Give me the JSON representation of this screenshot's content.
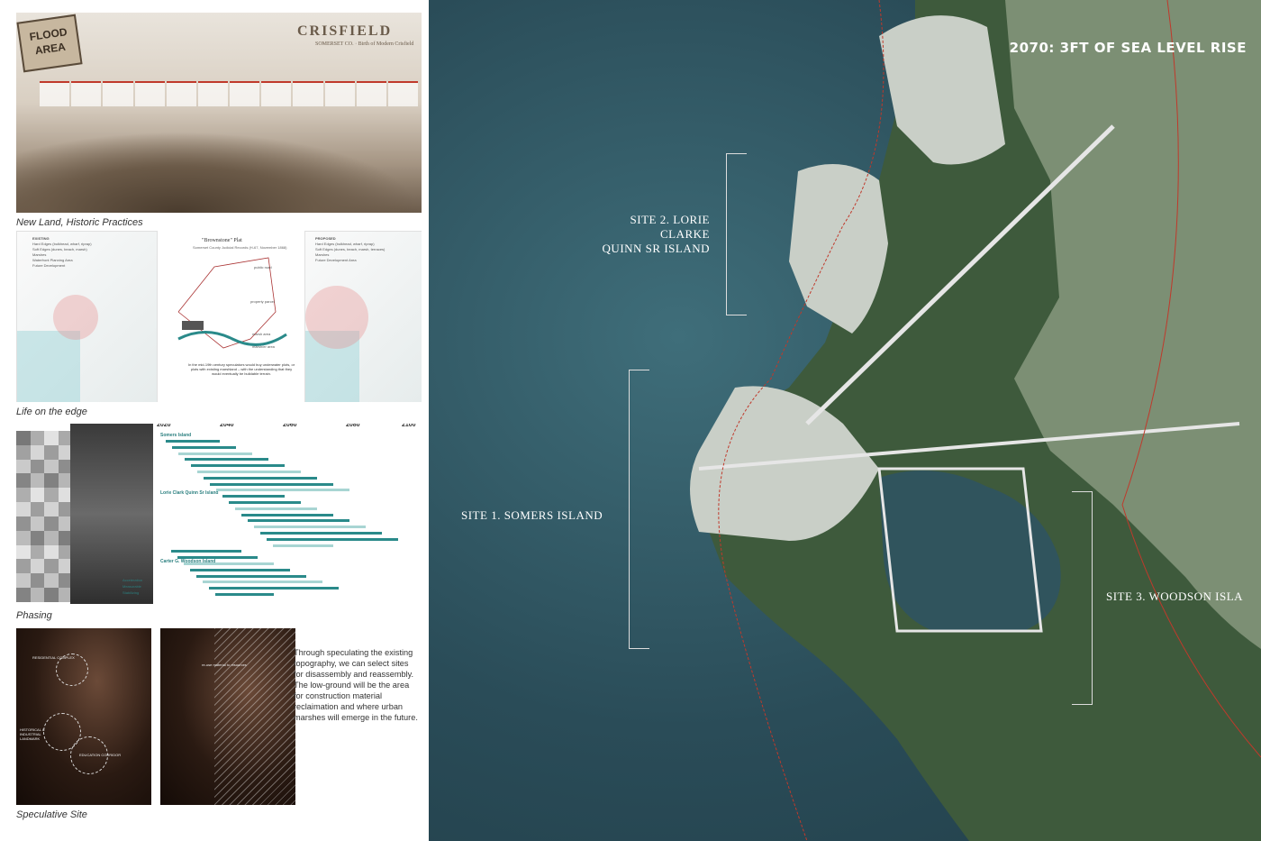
{
  "hero": {
    "sign_text": "FLOOD\nAREA",
    "title": "CRISFIELD",
    "subtitle": "SOMERSET CO. · Birth of Modern Crisfield"
  },
  "captions": {
    "new_land": "New Land, Historic Practices",
    "life": "Life on the edge",
    "phasing": "Phasing",
    "speculative": "Speculative Site"
  },
  "life": {
    "existing_label": "EXISTING",
    "existing_legend": [
      "Hard Edges (bulkhead, wharf, riprap)",
      "Soft Edges (dunes, beach, marsh)",
      "Marshes",
      "Waterfront Planning Area",
      "Future Development"
    ],
    "plot_title": "\"Brownstone\" Plat",
    "plot_subtitle": "Somerset County Judicial Records (H-67, November 1868)",
    "plot_labels": [
      "public road",
      "property parcel",
      "marsh area",
      "marsh/er area"
    ],
    "plot_note": "In the mid-19th century speculators would buy underwater plots, or plots with existing marshland – with the understanding that they would eventually be buildable terrain.",
    "proposed_label": "PROPOSED",
    "proposed_legend": [
      "Hard Edges (bulkhead, wharf, riprap)",
      "Soft Edges (dunes, beach, marsh, terraces)",
      "Marshes",
      "Future Development Area"
    ]
  },
  "phasing": {
    "years": [
      "2020",
      "2040",
      "2060",
      "2080",
      "2100"
    ],
    "groups": [
      "Somers Island",
      "Lorie Clark Quinn Sr Island",
      "Carter G. Woodson Island"
    ],
    "legend": [
      "Acceleration",
      "Measurable",
      "Stabilizing"
    ]
  },
  "speculative": {
    "labels": [
      "RESIDENTIAL COMPLEX",
      "HISTORICAL & INDUSTRIAL LANDMARK",
      "EDUCATION CORRIDOR",
      "re-use material to resources"
    ],
    "description": "Through speculating the existing topography, we can select sites for disassembly and reassembly. The low-ground will be the area for construction material reclaimation and where urban marshes will emerge in the future."
  },
  "main_map": {
    "title": "2070: 3FT OF SEA LEVEL RISE",
    "site1": "SITE 1. SOMERS ISLAND",
    "site2_line1": "SITE 2. LORIE CLARKE",
    "site2_line2": "QUINN SR ISLAND",
    "site3": "SITE 3. WOODSON ISLA"
  },
  "colors": {
    "water": "#2a4c58",
    "marsh": "#3e5a3c",
    "land": "#8a9a86",
    "accent_red": "#c0392b",
    "teal": "#2a8a8a",
    "ochre": "#b3823a"
  }
}
